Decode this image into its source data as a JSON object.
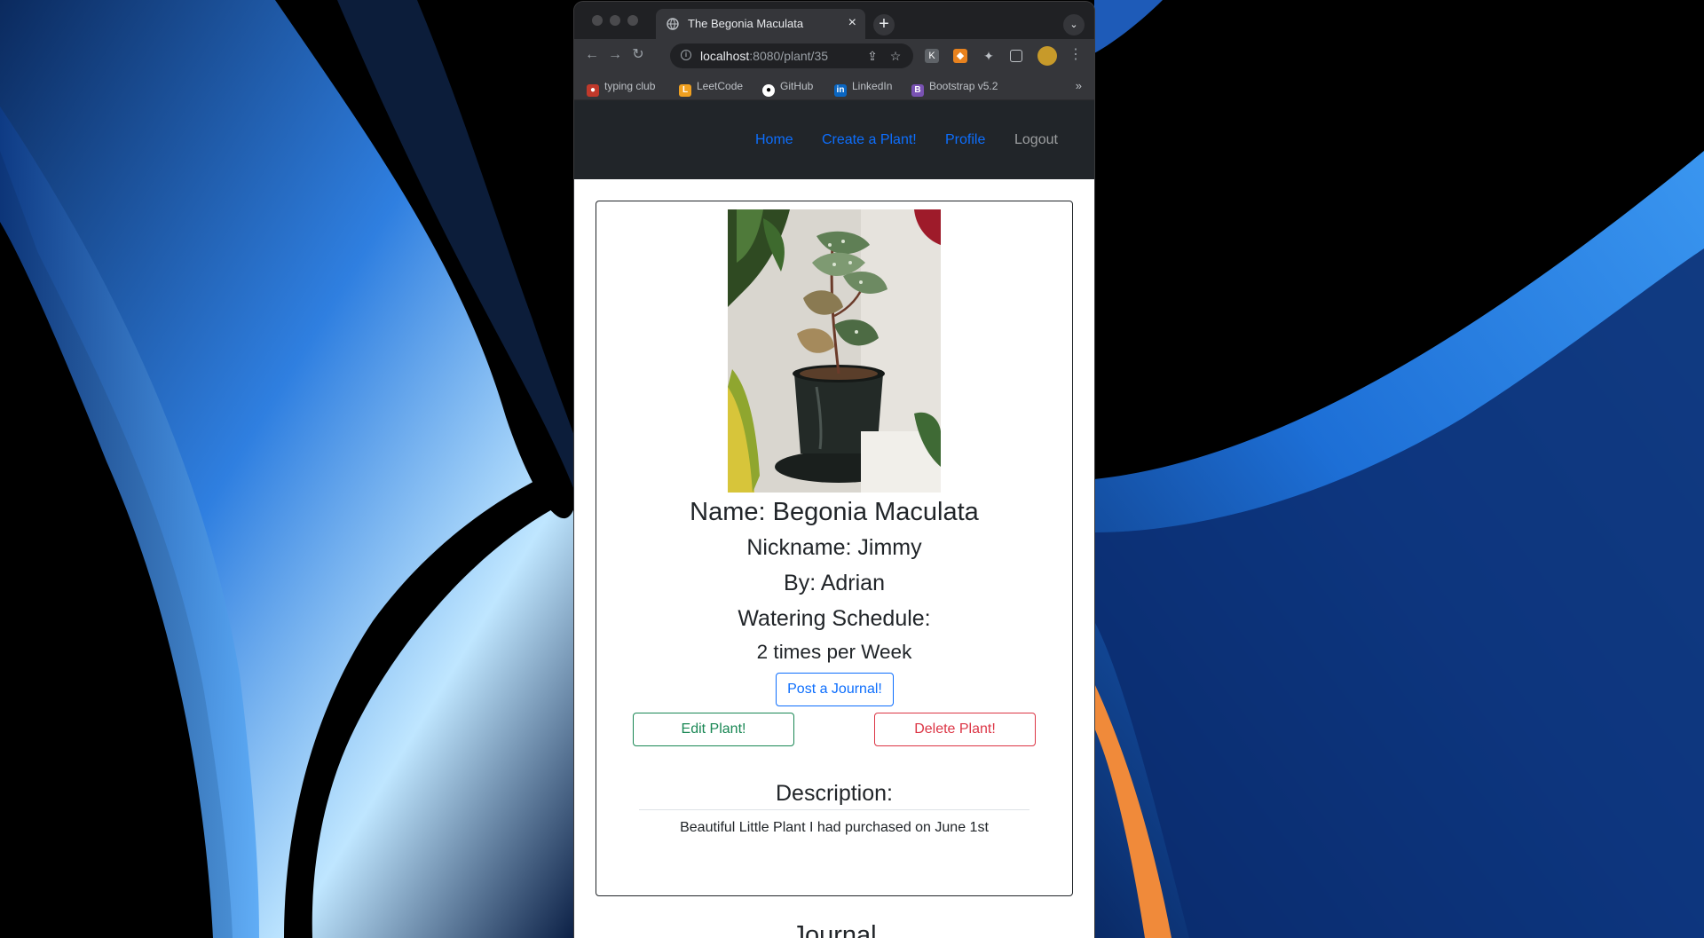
{
  "browser": {
    "tab_title": "The Begonia Maculata",
    "url_host": "localhost",
    "url_path": ":8080/plant/35",
    "bookmarks": [
      {
        "label": "typing club",
        "icon": "typing-club-icon"
      },
      {
        "label": "LeetCode",
        "icon": "leetcode-icon"
      },
      {
        "label": "GitHub",
        "icon": "github-icon"
      },
      {
        "label": "LinkedIn",
        "icon": "linkedin-icon"
      },
      {
        "label": "Bootstrap v5.2",
        "icon": "bootstrap-icon"
      }
    ]
  },
  "nav": {
    "home": "Home",
    "create": "Create a Plant!",
    "profile": "Profile",
    "logout": "Logout"
  },
  "plant": {
    "name": "Name: Begonia Maculata",
    "nickname": "Nickname: Jimmy",
    "by": "By: Adrian",
    "watering_label": "Watering Schedule:",
    "watering_value": "2 times per Week",
    "description_heading": "Description:",
    "description": "Beautiful Little Plant I had purchased on June 1st"
  },
  "buttons": {
    "post_journal": "Post a Journal!",
    "edit": "Edit Plant!",
    "delete": "Delete Plant!"
  },
  "journal": {
    "heading": "Journal"
  },
  "colors": {
    "primary": "#0d6efd",
    "success": "#198754",
    "danger": "#dc3545",
    "navbar": "#212529"
  }
}
